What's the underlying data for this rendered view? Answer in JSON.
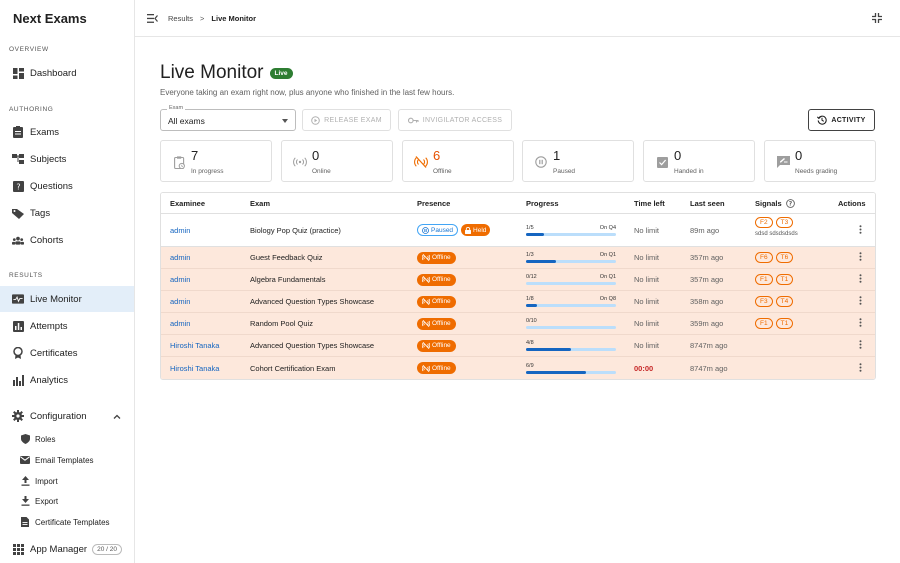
{
  "app": {
    "name": "Next Exams"
  },
  "sidebar": {
    "sections": {
      "overview": "OVERVIEW",
      "authoring": "AUTHORING",
      "results": "RESULTS"
    },
    "items": {
      "dashboard": "Dashboard",
      "exams": "Exams",
      "subjects": "Subjects",
      "questions": "Questions",
      "tags": "Tags",
      "cohorts": "Cohorts",
      "live_monitor": "Live Monitor",
      "attempts": "Attempts",
      "certificates": "Certificates",
      "analytics": "Analytics",
      "configuration": "Configuration"
    },
    "config_items": {
      "roles": "Roles",
      "email_templates": "Email Templates",
      "import": "Import",
      "export": "Export",
      "certificate_templates": "Certificate Templates"
    },
    "app_manager": {
      "label": "App Manager",
      "count": "20 / 20"
    }
  },
  "breadcrumb": {
    "parent": "Results",
    "current": "Live Monitor",
    "separator": ">"
  },
  "page": {
    "title": "Live Monitor",
    "live_badge": "Live",
    "subtitle": "Everyone taking an exam right now, plus anyone who finished in the last few hours."
  },
  "filters": {
    "exam_label": "Exam",
    "exam_value": "All exams"
  },
  "buttons": {
    "release": "RELEASE EXAM",
    "invigilator": "INVIGILATOR ACCESS",
    "activity": "ACTIVITY"
  },
  "stats": [
    {
      "value": "7",
      "label": "In progress"
    },
    {
      "value": "0",
      "label": "Online"
    },
    {
      "value": "6",
      "label": "Offline"
    },
    {
      "value": "1",
      "label": "Paused"
    },
    {
      "value": "0",
      "label": "Handed in"
    },
    {
      "value": "0",
      "label": "Needs grading"
    }
  ],
  "table": {
    "headers": {
      "examinee": "Examinee",
      "exam": "Exam",
      "presence": "Presence",
      "progress": "Progress",
      "time_left": "Time left",
      "last_seen": "Last seen",
      "signals": "Signals",
      "actions": "Actions"
    },
    "rows": [
      {
        "examinee": "admin",
        "exam": "Biology Pop Quiz (practice)",
        "presence": [
          "Paused",
          "Held"
        ],
        "progress": "1/5",
        "progress_q": "On Q4",
        "fraction": 0.2,
        "time_left": "No limit",
        "last_seen": "89m ago",
        "signals": [
          "F2",
          "T3"
        ],
        "signal_text": "sdsd sdsdsdsds"
      },
      {
        "examinee": "admin",
        "exam": "Guest Feedback Quiz",
        "presence": [
          "Offline"
        ],
        "progress": "1/3",
        "progress_q": "On Q1",
        "fraction": 0.33,
        "time_left": "No limit",
        "last_seen": "357m ago",
        "signals": [
          "F6",
          "T6"
        ],
        "signal_text": ""
      },
      {
        "examinee": "admin",
        "exam": "Algebra Fundamentals",
        "presence": [
          "Offline"
        ],
        "progress": "0/12",
        "progress_q": "On Q1",
        "fraction": 0,
        "time_left": "No limit",
        "last_seen": "357m ago",
        "signals": [
          "F1",
          "T1"
        ],
        "signal_text": ""
      },
      {
        "examinee": "admin",
        "exam": "Advanced Question Types Showcase",
        "presence": [
          "Offline"
        ],
        "progress": "1/8",
        "progress_q": "On Q8",
        "fraction": 0.125,
        "time_left": "No limit",
        "last_seen": "358m ago",
        "signals": [
          "F3",
          "T4"
        ],
        "signal_text": ""
      },
      {
        "examinee": "admin",
        "exam": "Random Pool Quiz",
        "presence": [
          "Offline"
        ],
        "progress": "0/10",
        "progress_q": "",
        "fraction": 0,
        "time_left": "No limit",
        "last_seen": "359m ago",
        "signals": [
          "F1",
          "T1"
        ],
        "signal_text": ""
      },
      {
        "examinee": "Hiroshi Tanaka",
        "exam": "Advanced Question Types Showcase",
        "presence": [
          "Offline"
        ],
        "progress": "4/8",
        "progress_q": "",
        "fraction": 0.5,
        "time_left": "No limit",
        "last_seen": "8747m ago",
        "signals": [],
        "signal_text": ""
      },
      {
        "examinee": "Hiroshi Tanaka",
        "exam": "Cohort Certification Exam",
        "presence": [
          "Offline"
        ],
        "progress": "6/9",
        "progress_q": "",
        "fraction": 0.667,
        "time_left": "00:00",
        "last_seen": "8747m ago",
        "signals": [],
        "signal_text": ""
      }
    ]
  },
  "colors": {
    "accent": "#1565c0",
    "offline": "#ef6c00",
    "live": "#2e7d32",
    "active_nav": "#e3eef9",
    "offline_row": "#fde8dc"
  }
}
